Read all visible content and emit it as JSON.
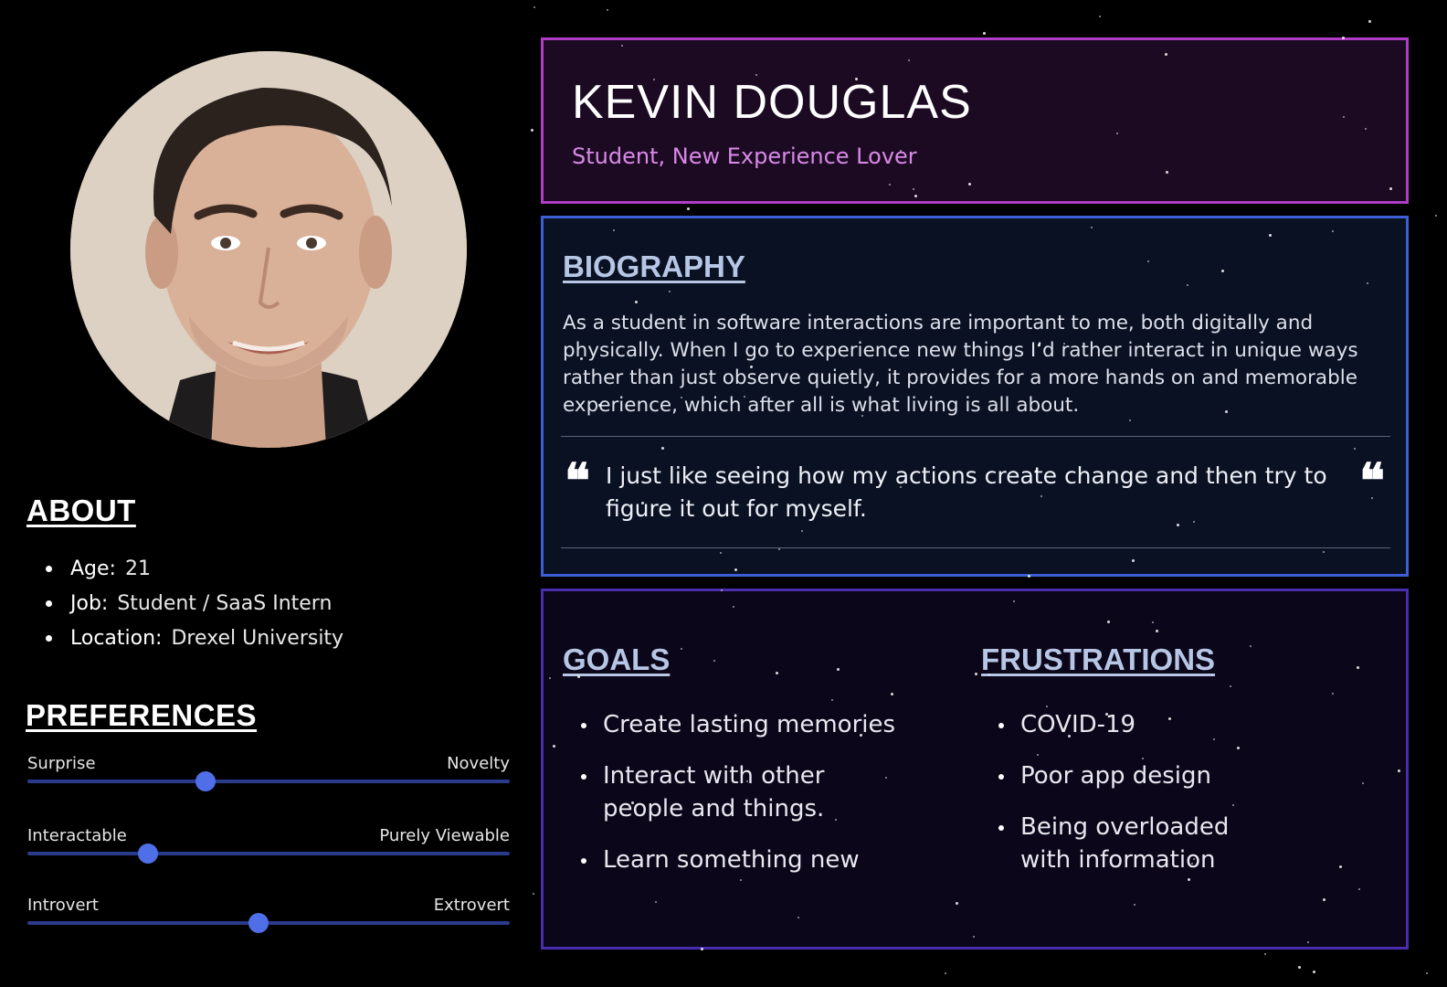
{
  "persona": {
    "name": "KEVIN DOUGLAS",
    "role": "Student, New Experience Lover"
  },
  "about": {
    "title": "ABOUT",
    "items": [
      {
        "key": "Age:",
        "value": "21"
      },
      {
        "key": "Job:",
        "value": "Student / SaaS Intern"
      },
      {
        "key": "Location:",
        "value": "Drexel University"
      }
    ]
  },
  "preferences": {
    "title": "PREFERENCES",
    "sliders": [
      {
        "left": "Surprise",
        "right": "Novelty",
        "value": 0.37
      },
      {
        "left": "Interactable",
        "right": "Purely Viewable",
        "value": 0.25
      },
      {
        "left": "Introvert",
        "right": "Extrovert",
        "value": 0.48
      }
    ]
  },
  "biography": {
    "title": "BIOGRAPHY",
    "text": "As a student in software interactions are important to me, both digitally and physically. When I go to experience new things I’d rather interact in unique ways rather than just observe quietly, it provides for a more hands on and memorable experience, which after all is what living is all about.",
    "quote": "I just like seeing how my actions create change and then try to figure it out for myself.",
    "quote_mark": "❝"
  },
  "goals": {
    "title": "GOALS",
    "items": [
      "Create lasting memories",
      "Interact with other people and things.",
      "Learn something new"
    ]
  },
  "frustrations": {
    "title": "FRUSTRATIONS",
    "items": [
      "COVID-19",
      "Poor app design",
      "Being overloaded with information"
    ]
  },
  "colors": {
    "name_border": "#b03cc8",
    "bio_border": "#3c5fd6",
    "goals_border": "#4a2cae",
    "role_text": "#d88ae6",
    "heading_text": "#b6c6e4",
    "slider_knob": "#4f6fe8",
    "slider_track": "#2b3b8c"
  }
}
